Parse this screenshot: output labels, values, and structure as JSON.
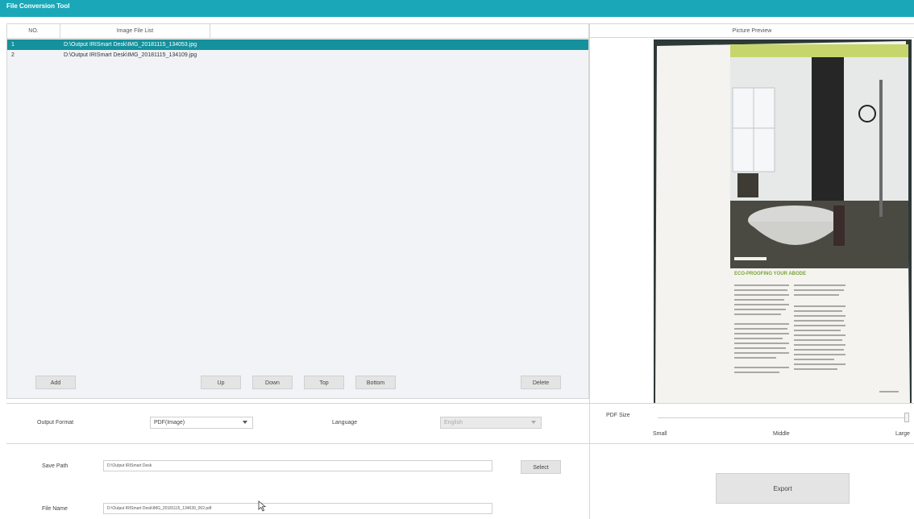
{
  "app": {
    "title": "File Conversion Tool"
  },
  "file_list": {
    "columns": [
      "NO.",
      "Image File List"
    ],
    "rows": [
      {
        "no": "1",
        "path": "D:\\Output IRISmart Desk\\IMG_20181115_134053.jpg",
        "selected": true
      },
      {
        "no": "2",
        "path": "D:\\Output IRISmart Desk\\IMG_20181115_134109.jpg",
        "selected": false
      }
    ]
  },
  "buttons": {
    "add": "Add",
    "up": "Up",
    "down": "Down",
    "top": "Top",
    "bottom": "Bottom",
    "delete": "Delete",
    "select": "Select",
    "export": "Export"
  },
  "output": {
    "format_label": "Output Format",
    "format_value": "PDF(Image)",
    "language_label": "Language",
    "language_value": "English"
  },
  "pdf_size": {
    "label": "PDF Size",
    "small": "Small",
    "middle": "Middle",
    "large": "Large",
    "level": 1.0
  },
  "save": {
    "path_label": "Save Path",
    "path_value": "D:\\Output IRISmart Desk",
    "name_label": "File Name",
    "name_value": "D:\\Output IRISmart Desk\\IMG_20181115_134639_002.pdf"
  },
  "preview": {
    "header": "Picture Preview",
    "page_heading": "ECO-PROOFING YOUR ABODE"
  },
  "colors": {
    "accent": "#1aa8b8",
    "selection": "#14919c"
  }
}
